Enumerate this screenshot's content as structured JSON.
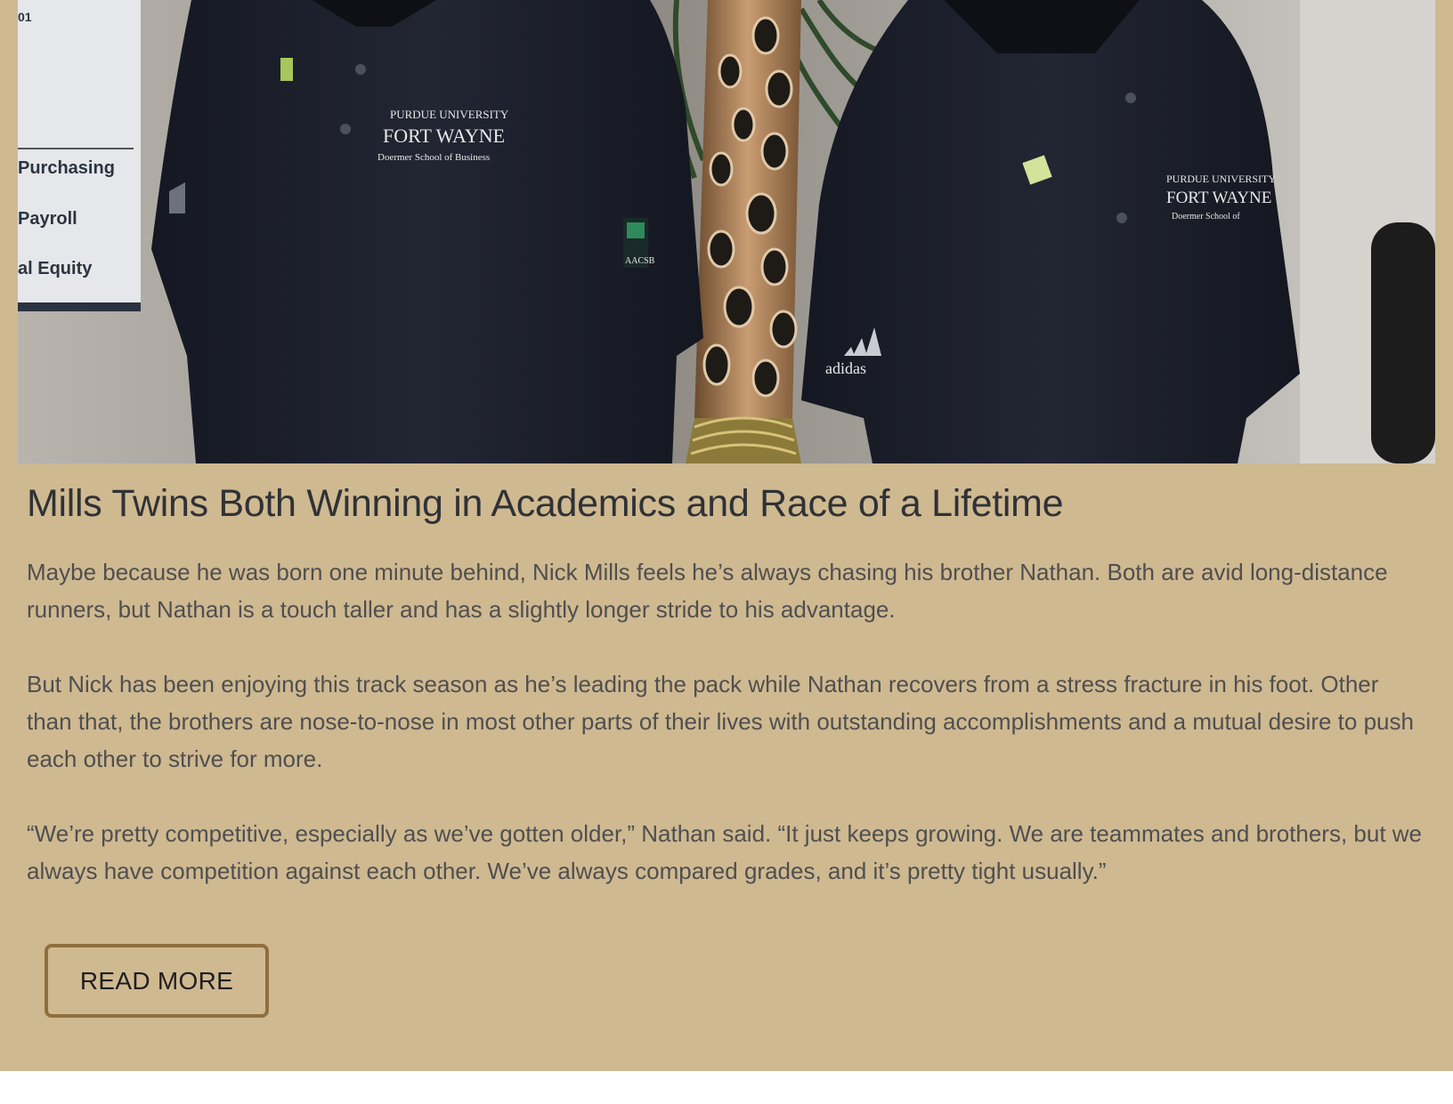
{
  "photo": {
    "sign_lines": [
      "01",
      "Purchasing",
      "Payroll",
      "al Equity"
    ],
    "shirt_left_logo": {
      "line1": "PURDUE UNIVERSITY",
      "line2": "FORT WAYNE",
      "line3": "Doermer School of Business"
    },
    "shirt_right_logo": {
      "line1": "PURDUE UNIVERSITY",
      "line2": "FORT WAYNE",
      "line3": "Doermer School of"
    },
    "sleeve_left_badge": "AACSB",
    "sleeve_right_brand": "adidas",
    "shirt_left_sleeve_brand": "adidas"
  },
  "article": {
    "title": "Mills Twins Both Winning in Academics and Race of a Lifetime",
    "paragraphs": [
      "Maybe because he was born one minute behind, Nick Mills feels he’s always chasing his brother Nathan. Both are avid long-distance runners, but Nathan is a touch taller and has a slightly longer stride to his advantage.",
      "But Nick has been enjoying this track season as he’s leading the pack while Nathan recovers from a stress fracture in his foot. Other than that, the brothers are nose-to-nose in most other parts of their lives with outstanding accomplishments and a mutual desire to push each other to strive for more.",
      "“We’re pretty competitive, especially as we’ve gotten older,” Nathan said. “It just keeps growing. We are teammates and brothers, but we always have competition against each other. We’ve always compared grades, and it’s pretty tight usually.”"
    ],
    "read_more_label": "READ MORE"
  },
  "colors": {
    "card_background": "#cfb991",
    "button_border": "#8e6f3e",
    "title_text": "#2f3236",
    "body_text": "#4f4f4f"
  }
}
